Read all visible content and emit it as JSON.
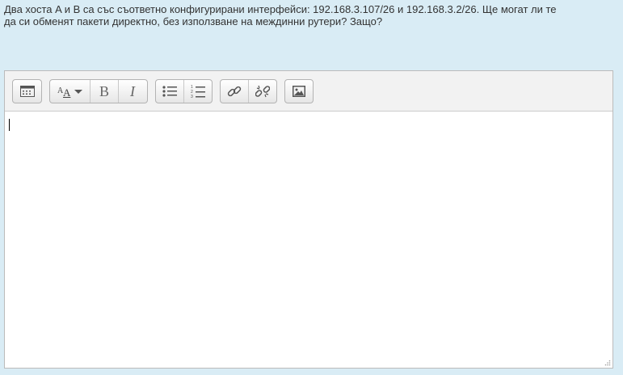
{
  "question": {
    "text": "Два хоста A и B са със съответно конфигурирани интерфейси: 192.168.3.107/26 и 192.168.3.2/26. Ще могат ли те да си обменят пакети директно, без използване на междинни рутери? Защо?"
  },
  "toolbar": {
    "buttons": [
      {
        "name": "show-more-buttons",
        "icon": "toolbar-toggle-icon"
      },
      {
        "name": "font-style",
        "icon": "text-style-icon"
      },
      {
        "name": "bold",
        "icon": "bold-icon"
      },
      {
        "name": "italic",
        "icon": "italic-icon"
      },
      {
        "name": "unordered-list",
        "icon": "bullet-list-icon"
      },
      {
        "name": "ordered-list",
        "icon": "numbered-list-icon"
      },
      {
        "name": "link",
        "icon": "link-icon"
      },
      {
        "name": "unlink",
        "icon": "unlink-icon"
      },
      {
        "name": "image",
        "icon": "image-icon"
      }
    ]
  },
  "editor": {
    "value": ""
  }
}
